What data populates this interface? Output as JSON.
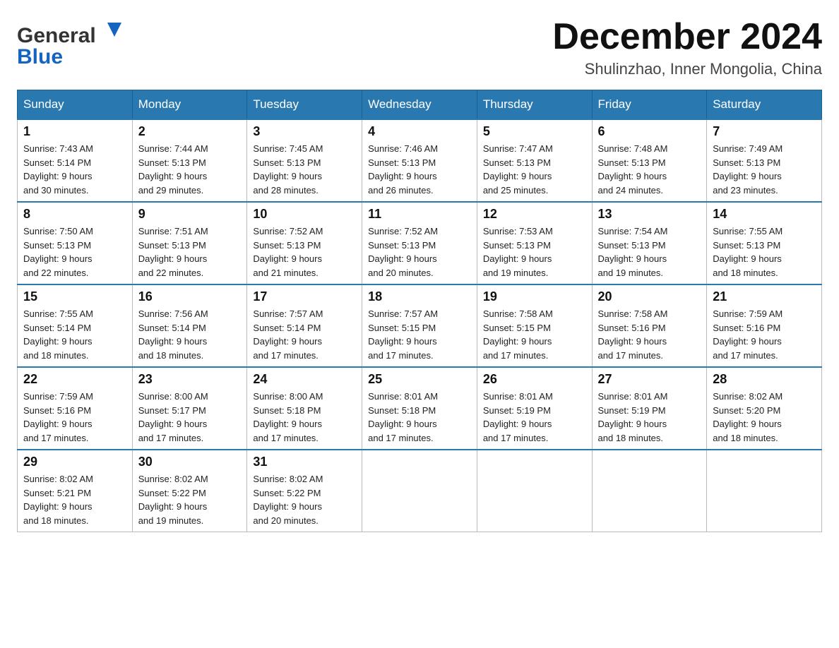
{
  "header": {
    "logo": {
      "general": "General",
      "blue": "Blue",
      "arrow_color": "#1565c0"
    },
    "title": "December 2024",
    "subtitle": "Shulinzhao, Inner Mongolia, China"
  },
  "calendar": {
    "days_of_week": [
      "Sunday",
      "Monday",
      "Tuesday",
      "Wednesday",
      "Thursday",
      "Friday",
      "Saturday"
    ],
    "weeks": [
      [
        {
          "day": "1",
          "sunrise": "7:43 AM",
          "sunset": "5:14 PM",
          "daylight": "9 hours and 30 minutes."
        },
        {
          "day": "2",
          "sunrise": "7:44 AM",
          "sunset": "5:13 PM",
          "daylight": "9 hours and 29 minutes."
        },
        {
          "day": "3",
          "sunrise": "7:45 AM",
          "sunset": "5:13 PM",
          "daylight": "9 hours and 28 minutes."
        },
        {
          "day": "4",
          "sunrise": "7:46 AM",
          "sunset": "5:13 PM",
          "daylight": "9 hours and 26 minutes."
        },
        {
          "day": "5",
          "sunrise": "7:47 AM",
          "sunset": "5:13 PM",
          "daylight": "9 hours and 25 minutes."
        },
        {
          "day": "6",
          "sunrise": "7:48 AM",
          "sunset": "5:13 PM",
          "daylight": "9 hours and 24 minutes."
        },
        {
          "day": "7",
          "sunrise": "7:49 AM",
          "sunset": "5:13 PM",
          "daylight": "9 hours and 23 minutes."
        }
      ],
      [
        {
          "day": "8",
          "sunrise": "7:50 AM",
          "sunset": "5:13 PM",
          "daylight": "9 hours and 22 minutes."
        },
        {
          "day": "9",
          "sunrise": "7:51 AM",
          "sunset": "5:13 PM",
          "daylight": "9 hours and 22 minutes."
        },
        {
          "day": "10",
          "sunrise": "7:52 AM",
          "sunset": "5:13 PM",
          "daylight": "9 hours and 21 minutes."
        },
        {
          "day": "11",
          "sunrise": "7:52 AM",
          "sunset": "5:13 PM",
          "daylight": "9 hours and 20 minutes."
        },
        {
          "day": "12",
          "sunrise": "7:53 AM",
          "sunset": "5:13 PM",
          "daylight": "9 hours and 19 minutes."
        },
        {
          "day": "13",
          "sunrise": "7:54 AM",
          "sunset": "5:13 PM",
          "daylight": "9 hours and 19 minutes."
        },
        {
          "day": "14",
          "sunrise": "7:55 AM",
          "sunset": "5:13 PM",
          "daylight": "9 hours and 18 minutes."
        }
      ],
      [
        {
          "day": "15",
          "sunrise": "7:55 AM",
          "sunset": "5:14 PM",
          "daylight": "9 hours and 18 minutes."
        },
        {
          "day": "16",
          "sunrise": "7:56 AM",
          "sunset": "5:14 PM",
          "daylight": "9 hours and 18 minutes."
        },
        {
          "day": "17",
          "sunrise": "7:57 AM",
          "sunset": "5:14 PM",
          "daylight": "9 hours and 17 minutes."
        },
        {
          "day": "18",
          "sunrise": "7:57 AM",
          "sunset": "5:15 PM",
          "daylight": "9 hours and 17 minutes."
        },
        {
          "day": "19",
          "sunrise": "7:58 AM",
          "sunset": "5:15 PM",
          "daylight": "9 hours and 17 minutes."
        },
        {
          "day": "20",
          "sunrise": "7:58 AM",
          "sunset": "5:16 PM",
          "daylight": "9 hours and 17 minutes."
        },
        {
          "day": "21",
          "sunrise": "7:59 AM",
          "sunset": "5:16 PM",
          "daylight": "9 hours and 17 minutes."
        }
      ],
      [
        {
          "day": "22",
          "sunrise": "7:59 AM",
          "sunset": "5:16 PM",
          "daylight": "9 hours and 17 minutes."
        },
        {
          "day": "23",
          "sunrise": "8:00 AM",
          "sunset": "5:17 PM",
          "daylight": "9 hours and 17 minutes."
        },
        {
          "day": "24",
          "sunrise": "8:00 AM",
          "sunset": "5:18 PM",
          "daylight": "9 hours and 17 minutes."
        },
        {
          "day": "25",
          "sunrise": "8:01 AM",
          "sunset": "5:18 PM",
          "daylight": "9 hours and 17 minutes."
        },
        {
          "day": "26",
          "sunrise": "8:01 AM",
          "sunset": "5:19 PM",
          "daylight": "9 hours and 17 minutes."
        },
        {
          "day": "27",
          "sunrise": "8:01 AM",
          "sunset": "5:19 PM",
          "daylight": "9 hours and 18 minutes."
        },
        {
          "day": "28",
          "sunrise": "8:02 AM",
          "sunset": "5:20 PM",
          "daylight": "9 hours and 18 minutes."
        }
      ],
      [
        {
          "day": "29",
          "sunrise": "8:02 AM",
          "sunset": "5:21 PM",
          "daylight": "9 hours and 18 minutes."
        },
        {
          "day": "30",
          "sunrise": "8:02 AM",
          "sunset": "5:22 PM",
          "daylight": "9 hours and 19 minutes."
        },
        {
          "day": "31",
          "sunrise": "8:02 AM",
          "sunset": "5:22 PM",
          "daylight": "9 hours and 20 minutes."
        },
        null,
        null,
        null,
        null
      ]
    ],
    "labels": {
      "sunrise": "Sunrise:",
      "sunset": "Sunset:",
      "daylight": "Daylight:"
    }
  }
}
